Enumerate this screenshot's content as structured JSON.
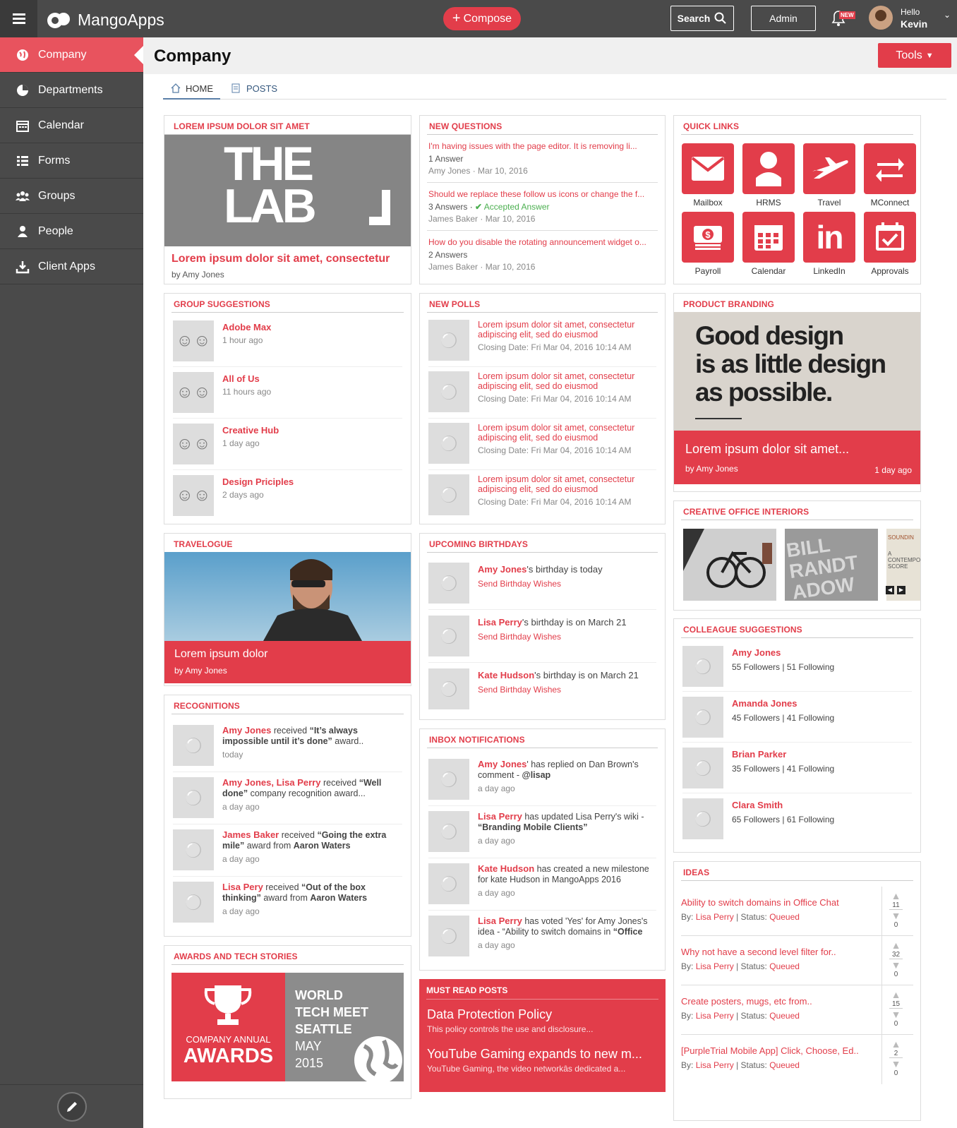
{
  "app": {
    "name": "MangoApps",
    "compose": "Compose",
    "search": "Search",
    "admin": "Admin",
    "new_badge": "NEW",
    "greeting": "Hello",
    "user": "Kevin"
  },
  "sidebar": {
    "items": [
      {
        "label": "Company",
        "icon": "globe-icon"
      },
      {
        "label": "Departments",
        "icon": "pie-chart-icon"
      },
      {
        "label": "Calendar",
        "icon": "calendar-icon"
      },
      {
        "label": "Forms",
        "icon": "list-icon"
      },
      {
        "label": "Groups",
        "icon": "group-icon"
      },
      {
        "label": "People",
        "icon": "person-icon"
      },
      {
        "label": "Client Apps",
        "icon": "download-icon"
      }
    ]
  },
  "page": {
    "title": "Company",
    "tools": "Tools",
    "tabs": [
      {
        "label": "HOME"
      },
      {
        "label": "POSTS"
      }
    ]
  },
  "featured": {
    "header": "LOREM IPSUM DOLOR SIT AMET",
    "image_line1": "THE",
    "image_line2": "LAB",
    "title": "Lorem ipsum dolor sit amet, consectetur",
    "by": "by Amy Jones"
  },
  "questions": {
    "header": "NEW QUESTIONS",
    "items": [
      {
        "title": "I'm having issues with the page editor. It is removing li...",
        "answers": "1 Answer",
        "accepted": "",
        "author": "Amy Jones",
        "date": "Mar 10, 2016"
      },
      {
        "title": "Should we replace these follow us icons or change the f...",
        "answers": "3 Answers",
        "accepted": "Accepted Answer",
        "author": "James Baker",
        "date": "Mar 10, 2016"
      },
      {
        "title": "How do you disable the rotating announcement widget o...",
        "answers": "2 Answers",
        "accepted": "",
        "author": "James Baker",
        "date": "Mar 10, 2016"
      }
    ]
  },
  "quicklinks": {
    "header": "QUICK LINKS",
    "items": [
      {
        "label": "Mailbox"
      },
      {
        "label": "HRMS"
      },
      {
        "label": "Travel"
      },
      {
        "label": "MConnect"
      },
      {
        "label": "Payroll"
      },
      {
        "label": "Calendar"
      },
      {
        "label": "LinkedIn"
      },
      {
        "label": "Approvals"
      }
    ]
  },
  "groups": {
    "header": "GROUP SUGGESTIONS",
    "items": [
      {
        "name": "Adobe Max",
        "time": "1 hour ago"
      },
      {
        "name": "All of Us",
        "time": "11 hours ago"
      },
      {
        "name": "Creative Hub",
        "time": "1 day ago"
      },
      {
        "name": "Design Priciples",
        "time": "2 days ago"
      }
    ]
  },
  "polls": {
    "header": "NEW POLLS",
    "items": [
      {
        "line1": "Lorem ipsum dolor sit amet, consectetur",
        "line2": "adipiscing elit, sed do eiusmod",
        "date": "Closing Date: Fri Mar 04, 2016 10:14 AM"
      },
      {
        "line1": "Lorem ipsum dolor sit amet, consectetur",
        "line2": "adipiscing elit, sed do eiusmod",
        "date": "Closing Date: Fri Mar 04, 2016 10:14 AM"
      },
      {
        "line1": "Lorem ipsum dolor sit amet, consectetur",
        "line2": "adipiscing elit, sed do eiusmod",
        "date": "Closing Date: Fri Mar 04, 2016 10:14 AM"
      },
      {
        "line1": "Lorem ipsum dolor sit amet, consectetur",
        "line2": "adipiscing elit, sed do eiusmod",
        "date": "Closing Date: Fri Mar 04, 2016 10:14 AM"
      }
    ]
  },
  "branding": {
    "header": "PRODUCT BRANDING",
    "quote1": "Good design",
    "quote2": "is as little design",
    "quote3": "as possible.",
    "title": "Lorem ipsum dolor sit amet...",
    "by": "by Amy Jones",
    "time": "1 day ago"
  },
  "interiors": {
    "header": "CREATIVE OFFICE INTERIORS",
    "img2": "BILL RANDT ADOW",
    "img3a": "SOUNDIN",
    "img3b": "A CONTEMPO SCORE"
  },
  "travelogue": {
    "header": "TRAVELOGUE",
    "title": "Lorem ipsum dolor",
    "by": "by Amy Jones"
  },
  "birthdays": {
    "header": "UPCOMING BIRTHDAYS",
    "items": [
      {
        "name": "Amy Jones",
        "text": "'s birthday is today",
        "action": "Send Birthday Wishes"
      },
      {
        "name": "Lisa Perry",
        "text": "'s birthday is on March 21",
        "action": "Send Birthday Wishes"
      },
      {
        "name": "Kate Hudson",
        "text": "'s birthday is on March 21",
        "action": "Send Birthday Wishes"
      }
    ]
  },
  "colleagues": {
    "header": "COLLEAGUE SUGGESTIONS",
    "items": [
      {
        "name": "Amy Jones",
        "followers": "55 Followers |",
        "following": "51 Following"
      },
      {
        "name": "Amanda Jones",
        "followers": "45 Followers |",
        "following": "41 Following"
      },
      {
        "name": "Brian Parker",
        "followers": "35 Followers |",
        "following": "41 Following"
      },
      {
        "name": "Clara Smith",
        "followers": "65 Followers |",
        "following": "61 Following"
      }
    ]
  },
  "recognitions": {
    "header": "RECOGNITIONS",
    "items": [
      {
        "name": "Amy Jones",
        "name2": "",
        "mid": " received ",
        "award": "“It’s always impossible until it’s done”",
        "rest": " award..",
        "from": "",
        "time": "today"
      },
      {
        "name": "Amy Jones",
        "name2": ", Lisa Perry",
        "mid": " received ",
        "award": "“Well done”",
        "rest": " company recognition award...",
        "from": "",
        "time": "a day ago"
      },
      {
        "name": "James Baker",
        "name2": "",
        "mid": " received ",
        "award": "“Going the extra mile”",
        "rest": " award from ",
        "from": "Aaron Waters",
        "time": "a day ago"
      },
      {
        "name": "Lisa Pery",
        "name2": "",
        "mid": " received ",
        "award": "“Out of the box thinking”",
        "rest": " award from ",
        "from": "Aaron Waters",
        "time": "a day ago"
      }
    ]
  },
  "inbox": {
    "header": "INBOX NOTIFICATIONS",
    "items": [
      {
        "name": "Amy Jones",
        "text": "' has replied on Dan Brown's comment - ",
        "bold": "@lisap",
        "time": "a day ago"
      },
      {
        "name": "Lisa Perry",
        "text": " has updated Lisa Perry's wiki - ",
        "bold": "“Branding Mobile Clients”",
        "time": "a day ago"
      },
      {
        "name": "Kate Hudson",
        "text": " has created a new milestone for kate Hudson in MangoApps 2016",
        "bold": "",
        "time": "a day ago"
      },
      {
        "name": "Lisa Perry",
        "text": " has voted 'Yes' for Amy Jones's idea - “Ability to switch domains in ",
        "bold": "“Office",
        "time": "a day ago"
      }
    ]
  },
  "ideas": {
    "header": "IDEAS",
    "items": [
      {
        "title": "Ability to switch domains in Office Chat",
        "by": "By:",
        "author": "Lisa Perry",
        "status_label": "| Status:",
        "status": "Queued",
        "up": "11",
        "down": "0"
      },
      {
        "title": "Why not have a second level filter for..",
        "by": "By:",
        "author": "Lisa Perry",
        "status_label": "| Status:",
        "status": "Queued",
        "up": "32",
        "down": "0"
      },
      {
        "title": "Create posters, mugs, etc from..",
        "by": "By:",
        "author": "Lisa Perry",
        "status_label": "| Status:",
        "status": "Queued",
        "up": "15",
        "down": "0"
      },
      {
        "title": "[PurpleTrial Mobile App] Click, Choose, Ed..",
        "by": "By:",
        "author": "Lisa Perry",
        "status_label": "| Status:",
        "status": "Queued",
        "up": "2",
        "down": "0"
      }
    ]
  },
  "awards": {
    "header": "AWARDS AND TECH STORIES",
    "left1": "COMPANY ANNUAL",
    "left2": "AWARDS",
    "right1": "WORLD",
    "right2": "TECH MEET",
    "right3": "SEATTLE",
    "right4": "MAY",
    "right5": "2015"
  },
  "mustread": {
    "header": "MUST READ POSTS",
    "items": [
      {
        "title": "Data Protection Policy",
        "desc": "This policy controls the use and disclosure..."
      },
      {
        "title": "YouTube Gaming expands to new m...",
        "desc": "YouTube Gaming, the video networkâs dedicated a..."
      }
    ]
  }
}
